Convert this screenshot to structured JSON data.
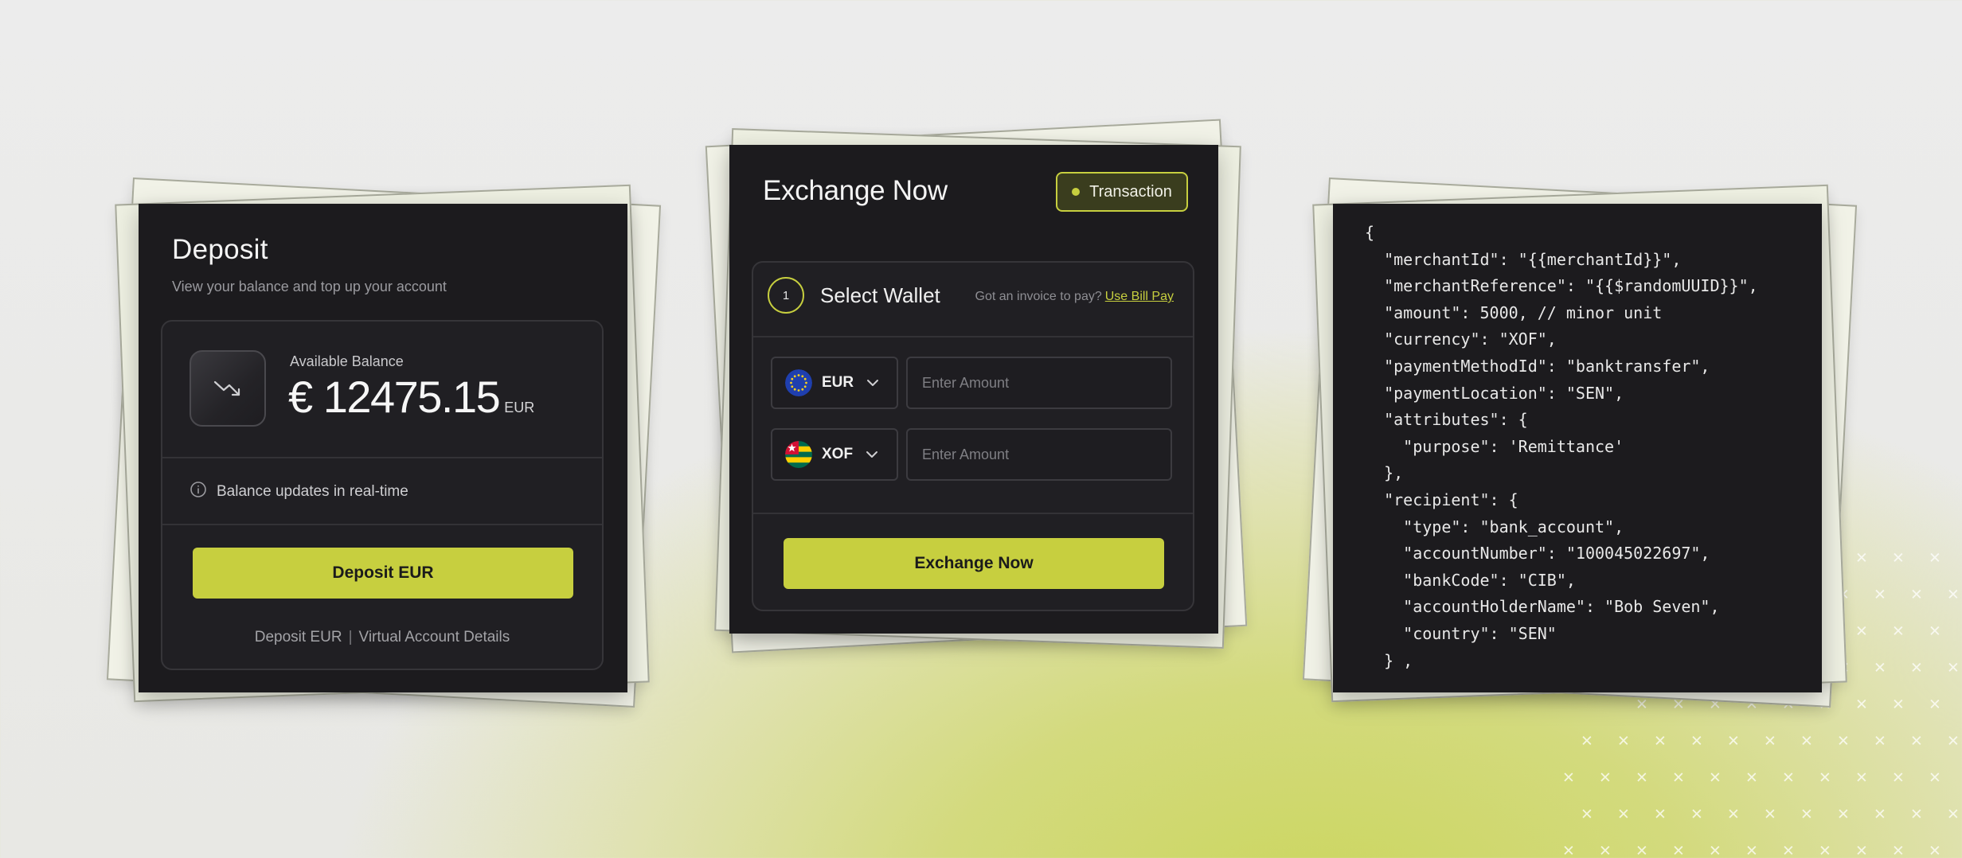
{
  "deposit": {
    "title": "Deposit",
    "subtitle": "View your balance and top up your account",
    "available_label": "Available Balance",
    "balance_amount": "€ 12475.15",
    "balance_currency": "EUR",
    "realtime_note": "Balance updates in real-time",
    "deposit_button": "Deposit EUR",
    "link_deposit": "Deposit EUR",
    "link_separator": "|",
    "link_virtual": "Virtual Account Details",
    "icons": {
      "balance": "trend-down-icon",
      "info": "info-icon"
    }
  },
  "exchange": {
    "title": "Exchange Now",
    "badge_label": "Transaction",
    "step_number": "1",
    "step_title": "Select Wallet",
    "invoice_prompt": "Got an invoice to pay?",
    "invoice_link": "Use Bill Pay",
    "rows": [
      {
        "currency": "EUR",
        "flag": "eu-flag-icon",
        "placeholder": "Enter Amount"
      },
      {
        "currency": "XOF",
        "flag": "togo-flag-icon",
        "placeholder": "Enter Amount"
      }
    ],
    "button_label": "Exchange Now"
  },
  "code": {
    "lines": [
      "{",
      "  \"merchantId\": \"{{merchantId}}\",",
      "  \"merchantReference\": \"{{$randomUUID}}\",",
      "  \"amount\": 5000, // minor unit",
      "  \"currency\": \"XOF\",",
      "  \"paymentMethodId\": \"banktransfer\",",
      "  \"paymentLocation\": \"SEN\",",
      "  \"attributes\": {",
      "    \"purpose\": 'Remittance'",
      "  },",
      "  \"recipient\": {",
      "    \"type\": \"bank_account\",",
      "    \"accountNumber\": \"100045022697\",",
      "    \"bankCode\": \"CIB\",",
      "    \"accountHolderName\": \"Bob Seven\",",
      "    \"country\": \"SEN\"",
      "  } ,"
    ]
  },
  "colors": {
    "accent": "#c7cf3f",
    "card_bg": "#1c1b1e",
    "page_bg": "#ececec"
  }
}
